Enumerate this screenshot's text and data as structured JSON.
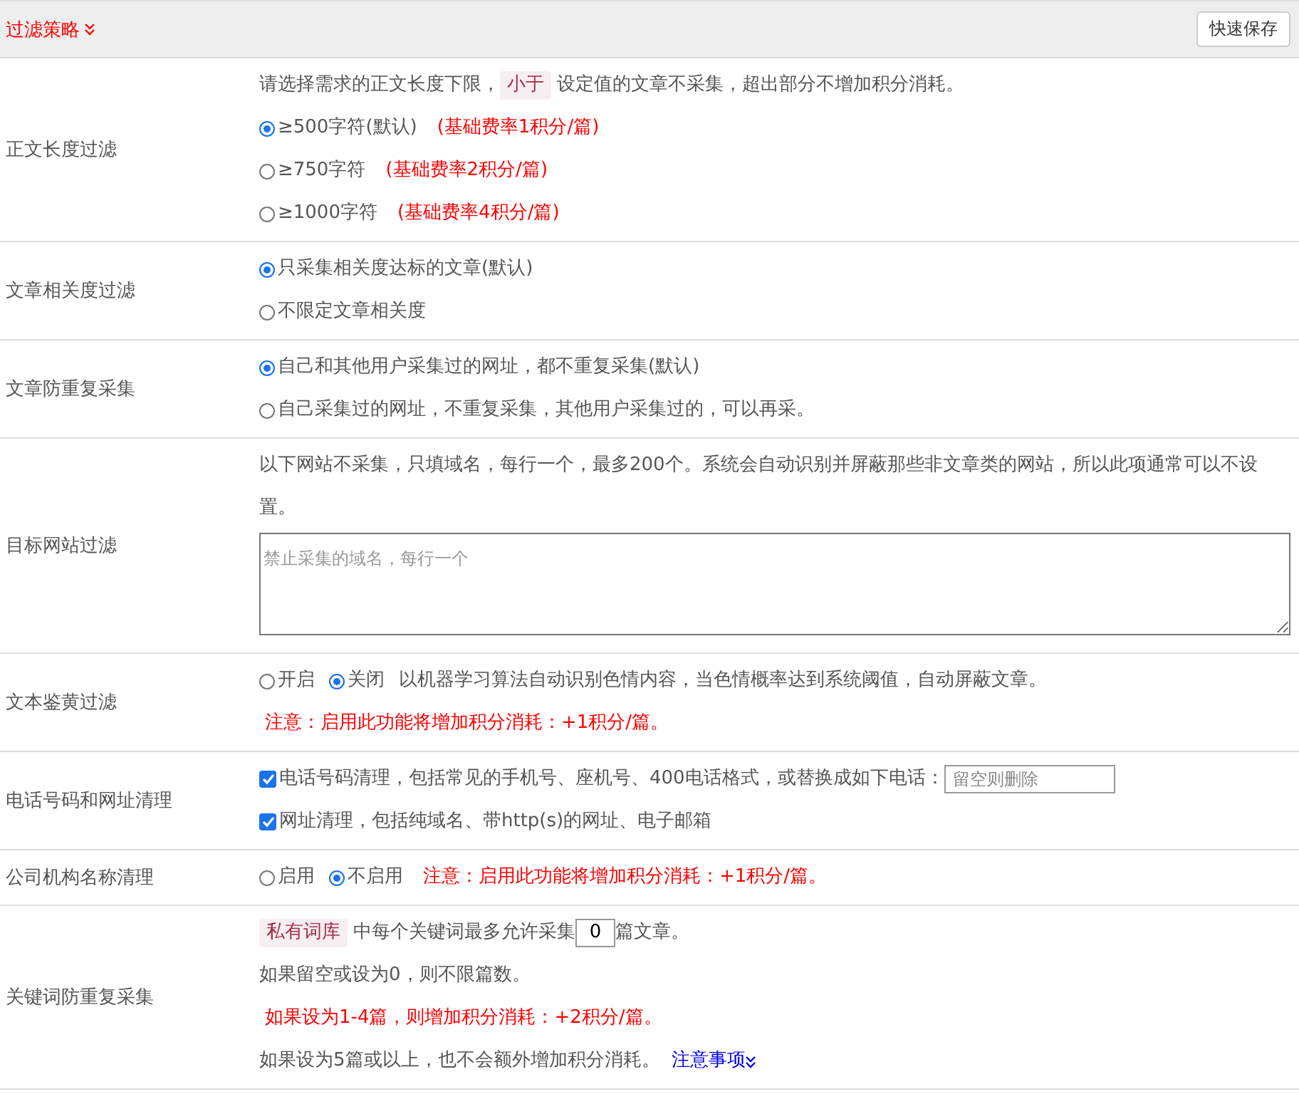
{
  "header": {
    "title": "过滤策略",
    "save_button": "快速保存"
  },
  "rows": [
    {
      "label": "正文长度过滤",
      "lines": [
        [
          {
            "kind": "text",
            "text": "请选择需求的正文长度下限，"
          },
          {
            "kind": "tag",
            "text": "小于"
          },
          {
            "kind": "text",
            "text": "设定值的文章不采集，超出部分不增加积分消耗。"
          }
        ],
        [
          {
            "kind": "radio",
            "text": "≥500字符(默认)",
            "selected": true
          },
          {
            "kind": "note",
            "text": "(基础费率1积分/篇)"
          }
        ],
        [
          {
            "kind": "radio",
            "text": "≥750字符",
            "selected": false
          },
          {
            "kind": "note",
            "text": "(基础费率2积分/篇)"
          }
        ],
        [
          {
            "kind": "radio",
            "text": "≥1000字符",
            "selected": false
          },
          {
            "kind": "note",
            "text": "(基础费率4积分/篇)"
          }
        ]
      ]
    },
    {
      "label": "文章相关度过滤",
      "lines": [
        [
          {
            "kind": "radio",
            "text": "只采集相关度达标的文章(默认)",
            "selected": true
          }
        ],
        [
          {
            "kind": "radio",
            "text": "不限定文章相关度",
            "selected": false
          }
        ]
      ]
    },
    {
      "label": "文章防重复采集",
      "lines": [
        [
          {
            "kind": "radio",
            "text": "自己和其他用户采集过的网址，都不重复采集(默认)",
            "selected": true
          }
        ],
        [
          {
            "kind": "radio",
            "text": "自己采集过的网址，不重复采集，其他用户采集过的，可以再采。",
            "selected": false
          }
        ]
      ]
    },
    {
      "label": "目标网站过滤",
      "lines": [
        [
          {
            "kind": "text",
            "text": "以下网站不采集，只填域名，每行一个，最多200个。系统会自动识别并屏蔽那些非文章类的网站，所以此项通常可以不设置。"
          }
        ],
        [
          {
            "kind": "textarea",
            "placeholder": "禁止采集的域名，每行一个"
          }
        ]
      ]
    },
    {
      "label": "文本鉴黄过滤",
      "lines": [
        [
          {
            "kind": "radio",
            "text": "开启",
            "selected": false
          },
          {
            "kind": "radio",
            "text": "关闭",
            "selected": true
          },
          {
            "kind": "text",
            "text": "以机器学习算法自动识别色情内容，当色情概率达到系统阈值，自动屏蔽文章。"
          }
        ],
        [
          {
            "kind": "note",
            "text": "注意：启用此功能将增加积分消耗：+1积分/篇。"
          }
        ]
      ]
    },
    {
      "label": "电话号码和网址清理",
      "lines": [
        [
          {
            "kind": "checkbox",
            "text": "电话号码清理，包括常见的手机号、座机号、400电话格式，或替换成如下电话：",
            "checked": true
          },
          {
            "kind": "input",
            "placeholder": "留空则删除"
          }
        ],
        [
          {
            "kind": "checkbox",
            "text": "网址清理，包括纯域名、带http(s)的网址、电子邮箱",
            "checked": true
          }
        ]
      ]
    },
    {
      "label": "公司机构名称清理",
      "lines": [
        [
          {
            "kind": "radio",
            "text": "启用",
            "selected": false
          },
          {
            "kind": "radio",
            "text": "不启用",
            "selected": true
          },
          {
            "kind": "note",
            "text": "注意：启用此功能将增加积分消耗：+1积分/篇。"
          }
        ]
      ]
    },
    {
      "label": "关键词防重复采集",
      "lines": [
        [
          {
            "kind": "tag",
            "text": "私有词库"
          },
          {
            "kind": "text",
            "text": "中每个关键词最多允许采集"
          },
          {
            "kind": "number",
            "value": "0"
          },
          {
            "kind": "text",
            "text": "篇文章。"
          }
        ],
        [
          {
            "kind": "text",
            "text": "如果留空或设为0，则不限篇数。"
          }
        ],
        [
          {
            "kind": "note",
            "text": "如果设为1-4篇，则增加积分消耗：+2积分/篇。"
          }
        ],
        [
          {
            "kind": "text",
            "text": "如果设为5篇或以上，也不会额外增加积分消耗。"
          },
          {
            "kind": "link",
            "text": "注意事项"
          }
        ]
      ]
    }
  ]
}
